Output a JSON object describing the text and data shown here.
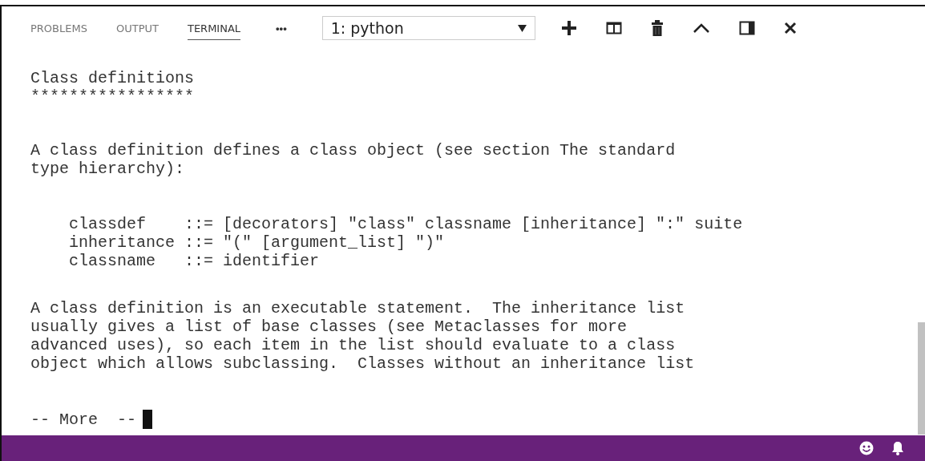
{
  "tabs": [
    {
      "label": "PROBLEMS",
      "selected": false
    },
    {
      "label": "OUTPUT",
      "selected": false
    },
    {
      "label": "TERMINAL",
      "selected": true
    }
  ],
  "more_actions": "•••",
  "terminal_select": {
    "value": "1: python"
  },
  "terminal_blocks": [
    {
      "kind": "heading",
      "lines": [
        "Class definitions",
        "*****************"
      ]
    },
    {
      "kind": "paragraph",
      "lines": [
        "A class definition defines a class object (see section The standard",
        "type hierarchy):"
      ]
    },
    {
      "kind": "grammar",
      "lines": [
        "classdef    ::= [decorators] \"class\" classname [inheritance] \":\" suite",
        "inheritance ::= \"(\" [argument_list] \")\"",
        "classname   ::= identifier"
      ]
    },
    {
      "kind": "paragraph",
      "lines": [
        "A class definition is an executable statement.  The inheritance list",
        "usually gives a list of base classes (see Metaclasses for more",
        "advanced uses), so each item in the list should evaluate to a class",
        "object which allows subclassing.  Classes without an inheritance list"
      ]
    }
  ],
  "prompt": "-- More  --"
}
